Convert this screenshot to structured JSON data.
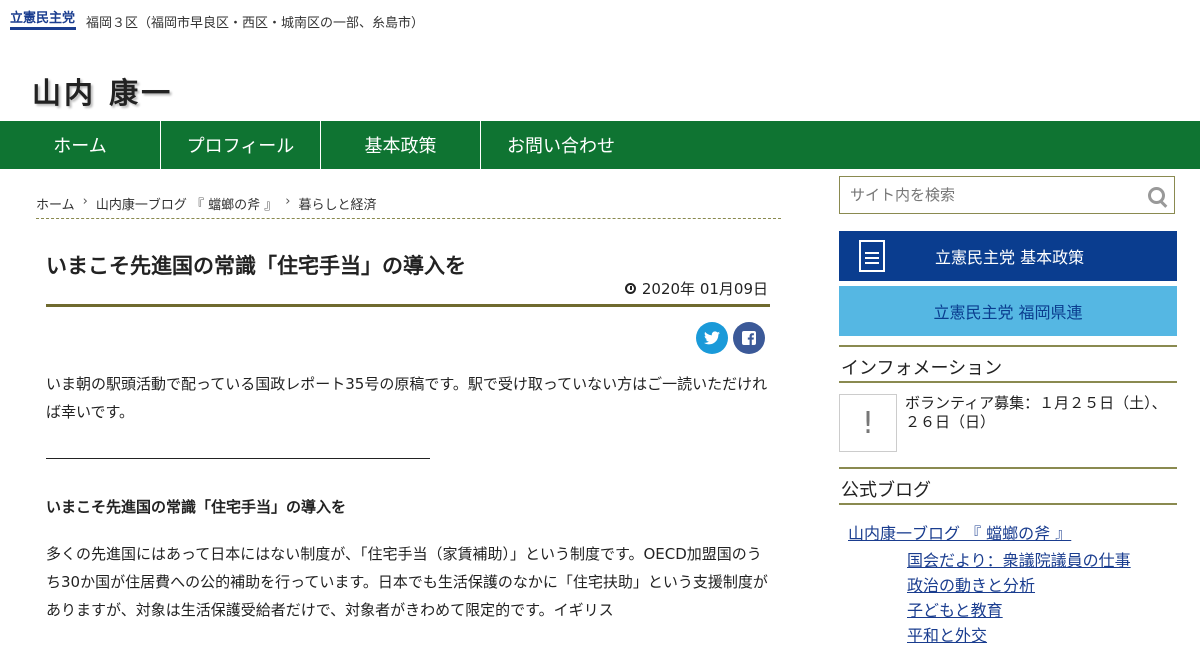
{
  "header": {
    "party_logo_text": "立憲民主党",
    "district": "福岡３区（福岡市早良区・西区・城南区の一部、糸島市）",
    "site_title": "山内 康一"
  },
  "nav": {
    "home": "ホーム",
    "profile": "プロフィール",
    "policy": "基本政策",
    "contact": "お問い合わせ"
  },
  "breadcrumb": {
    "items": [
      "ホーム",
      "山内康一ブログ 『 蟷螂の斧 』",
      "暮らしと経済"
    ]
  },
  "article": {
    "title": "いまこそ先進国の常識「住宅手当」の導入を",
    "date": "2020年 01月09日",
    "intro": "いま朝の駅頭活動で配っている国政レポート35号の原稿です。駅で受け取っていない方はご一読いただければ幸いです。",
    "subheading": "いまこそ先進国の常識「住宅手当」の導入を",
    "body": "多くの先進国にはあって日本にはない制度が、「住宅手当（家賃補助）」という制度です。OECD加盟国のうち30か国が住居費への公的補助を行っています。日本でも生活保護のなかに「住宅扶助」という支援制度がありますが、対象は生活保護受給者だけで、対象者がきわめて限定的です。イギリス"
  },
  "share": {
    "twitter_icon": "twitter-icon",
    "facebook_icon": "facebook-icon"
  },
  "sidebar": {
    "search_placeholder": "サイト内を検索",
    "banner_policy": "立憲民主党 基本政策",
    "banner_fukuoka": "立憲民主党 福岡県連",
    "info_heading": "インフォメーション",
    "info_text": "ボランティア募集：１月２５日（土）、２６日（日）",
    "blog_heading": "公式ブログ",
    "blog_root": "山内康一ブログ 『 蟷螂の斧 』",
    "blog_categories": [
      "国会だより：衆議院議員の仕事",
      "政治の動きと分析",
      "子どもと教育",
      "平和と外交"
    ]
  },
  "colors": {
    "nav_green": "#0f7432",
    "policy_blue": "#0a3d8f",
    "fukuoka_light_blue": "#55b7e3",
    "rule_olive": "#6f6a2f"
  }
}
